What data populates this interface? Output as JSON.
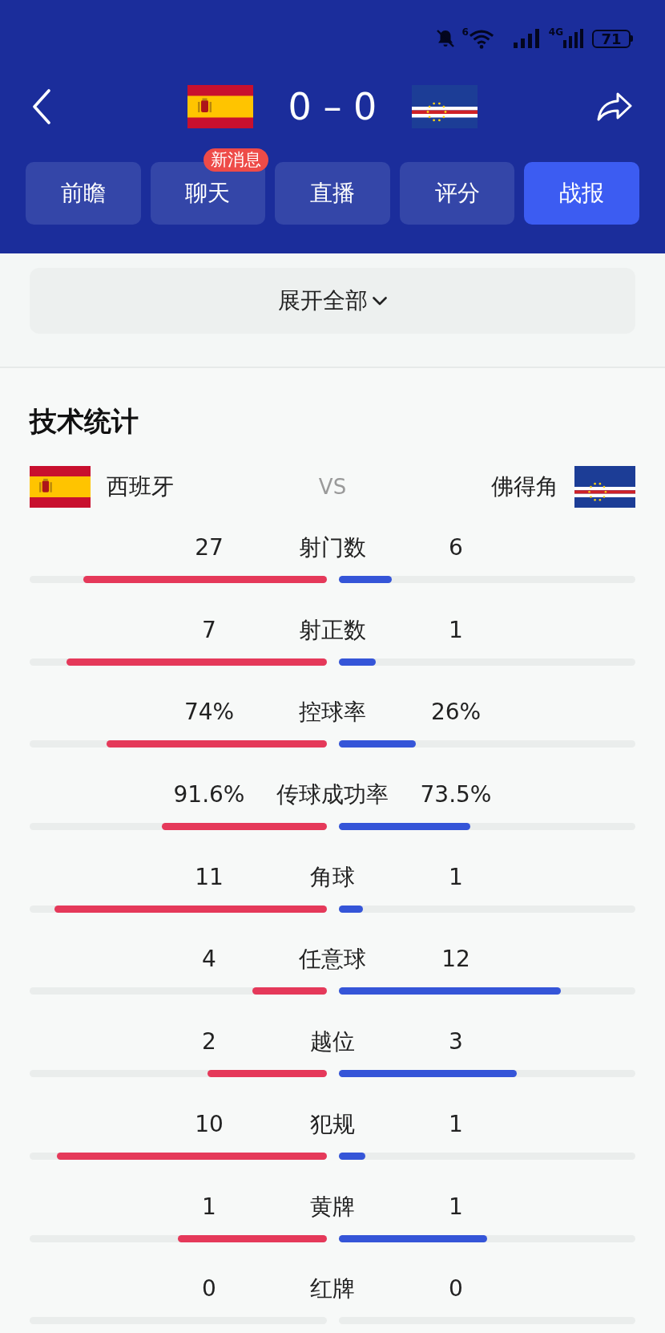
{
  "status_bar": {
    "wifi_label": "6",
    "network": "4G",
    "battery": "71"
  },
  "match": {
    "score": "0 – 0"
  },
  "tabs": [
    {
      "label": "前瞻",
      "selected": false
    },
    {
      "label": "聊天",
      "selected": false,
      "badge": "新消息"
    },
    {
      "label": "直播",
      "selected": false
    },
    {
      "label": "评分",
      "selected": false
    },
    {
      "label": "战报",
      "selected": true
    }
  ],
  "expand_button": {
    "label": "展开全部"
  },
  "technical_stats": {
    "title": "技术统计",
    "home_team": "西班牙",
    "versus": "VS",
    "away_team": "佛得角",
    "rows": [
      {
        "label": "射门数",
        "home": {
          "value": "27",
          "level": 0.82
        },
        "away": {
          "value": "6",
          "level": 0.18
        }
      },
      {
        "label": "射正数",
        "home": {
          "value": "7",
          "level": 0.875
        },
        "away": {
          "value": "1",
          "level": 0.125
        }
      },
      {
        "label": "控球率",
        "home": {
          "value": "74%",
          "level": 0.74
        },
        "away": {
          "value": "26%",
          "level": 0.26
        }
      },
      {
        "label": "传球成功率",
        "home": {
          "value": "91.6%",
          "level": 0.555
        },
        "away": {
          "value": "73.5%",
          "level": 0.445
        }
      },
      {
        "label": "角球",
        "home": {
          "value": "11",
          "level": 0.917
        },
        "away": {
          "value": "1",
          "level": 0.083
        }
      },
      {
        "label": "任意球",
        "home": {
          "value": "4",
          "level": 0.25
        },
        "away": {
          "value": "12",
          "level": 0.75
        }
      },
      {
        "label": "越位",
        "home": {
          "value": "2",
          "level": 0.4
        },
        "away": {
          "value": "3",
          "level": 0.6
        }
      },
      {
        "label": "犯规",
        "home": {
          "value": "10",
          "level": 0.909
        },
        "away": {
          "value": "1",
          "level": 0.091
        }
      },
      {
        "label": "黄牌",
        "home": {
          "value": "1",
          "level": 0.5
        },
        "away": {
          "value": "1",
          "level": 0.5
        }
      },
      {
        "label": "红牌",
        "home": {
          "value": "0"
        },
        "away": {
          "value": "0"
        }
      }
    ]
  }
}
